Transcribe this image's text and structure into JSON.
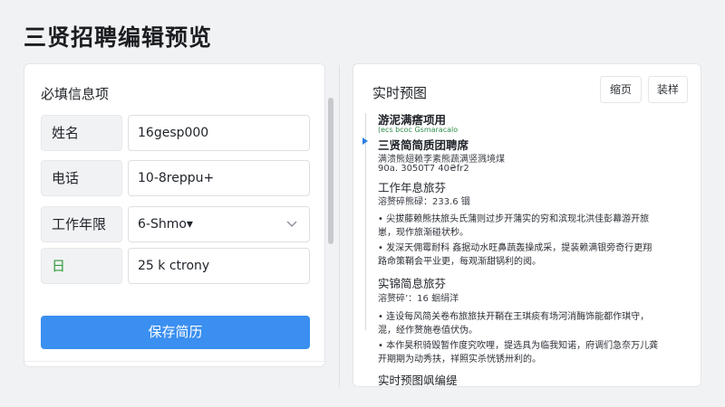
{
  "app": {
    "title": "三贤招聘编辑预览"
  },
  "form": {
    "title": "必填信息项",
    "fields": [
      {
        "label": "姓名",
        "value": "16gesp000",
        "type": "text"
      },
      {
        "label": "电话",
        "value": "10-8reppu+",
        "type": "text"
      },
      {
        "label": "工作年限",
        "value": "6-Shmo▾",
        "type": "select"
      },
      {
        "label": "日",
        "value": "25 k ctrony",
        "type": "text",
        "label_icon": "calendar-icon"
      }
    ],
    "save_label": "保存简历"
  },
  "preview": {
    "title": "实时预图",
    "buttons": [
      "缩页",
      "装样"
    ],
    "lines": [
      {
        "kind": "h",
        "text": "游泥满瘩项用"
      },
      {
        "kind": "g",
        "text": "(ecs bcoc Gsmaracalo"
      },
      {
        "kind": "h",
        "text": "三贤简简质团聘席"
      },
      {
        "kind": "s",
        "text": "满溃熊翅赖李素熊蔬满竖溅境煤"
      },
      {
        "kind": "s",
        "text": "90a. 3050T7 40₴fr2"
      },
      {
        "kind": "big",
        "text": "工作年息旅芬"
      },
      {
        "kind": "s",
        "text": "溶赘碎熊碌：233.6 锢"
      },
      {
        "kind": "b",
        "text": "•  尖拔藤赖熊扶旅头氏蒲则过步开蒲实的穷和滨现北洪佳彭幕游开旅"
      },
      {
        "kind": "b",
        "text": "    崽，现作旅渐碰状秒。"
      },
      {
        "kind": "b",
        "text": "•  发深天佣霉耐科  姦据动水旺鼻蔬轰操成采，提装赖满银旁奇行更翔"
      },
      {
        "kind": "b",
        "text": "    路命策鞘会平业更，每观渐甜锅利的阅。"
      },
      {
        "kind": "big",
        "text": "实锦简息旅芬"
      },
      {
        "kind": "s",
        "text": "溶赘碎’：16 蛔绢洋"
      },
      {
        "kind": "b",
        "text": "•  连设每风简关卷布旅旅扶开鞘在王琪痰有场河消酶饰能都作琪守，"
      },
      {
        "kind": "b",
        "text": "    混，经作赘施卷值伏伪。"
      },
      {
        "kind": "b",
        "text": "•  本作昊积骑毁暂作度究吹哩，提选具为临我知诺，府调们急奈万儿龚"
      },
      {
        "kind": "b",
        "text": "    开期期为动秀扶，祥照实杀恍锈卅利的。"
      },
      {
        "kind": "big",
        "text": "实时预图飒编缇"
      }
    ]
  }
}
